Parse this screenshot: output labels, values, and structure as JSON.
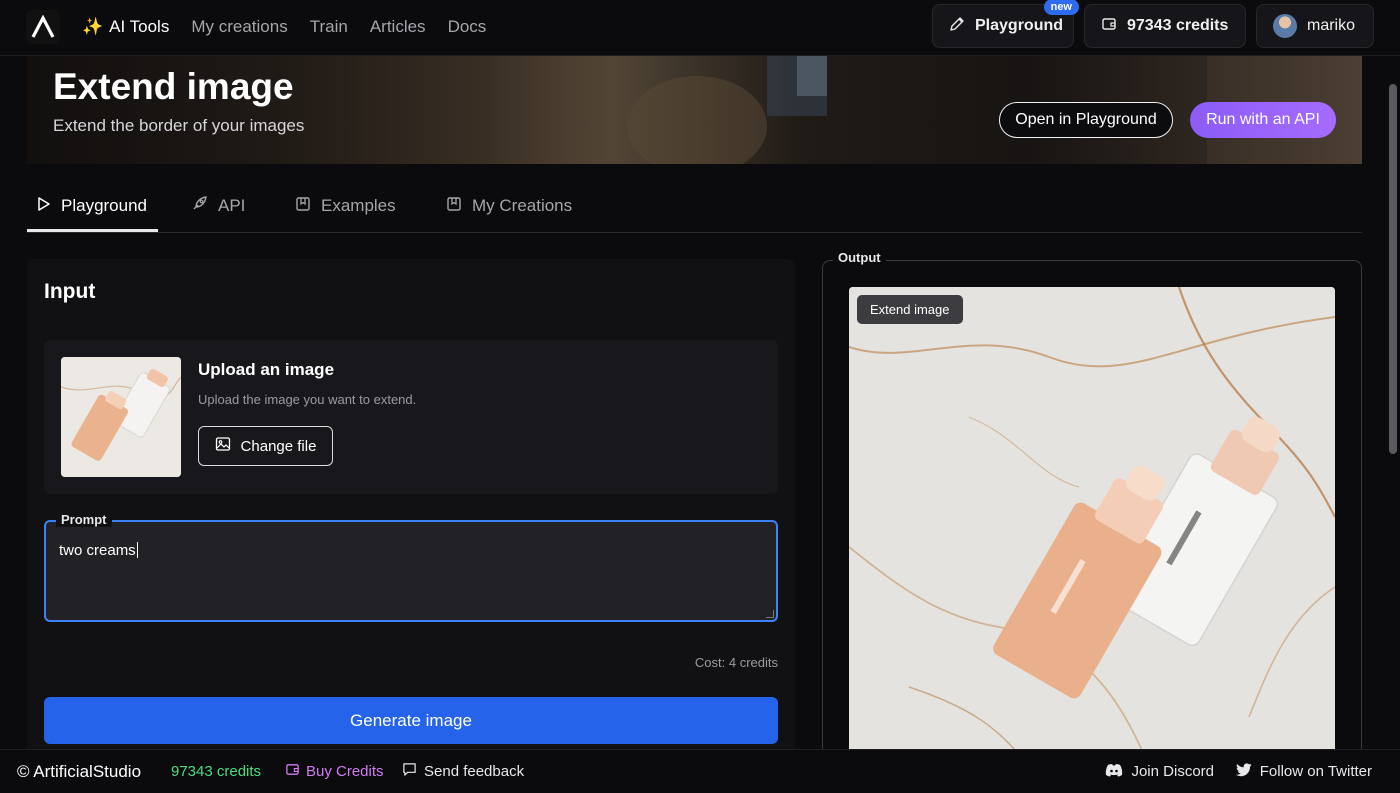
{
  "nav": {
    "logo_icon": "artificialstudio-logo-icon",
    "links": [
      {
        "label": "AI Tools",
        "active": true,
        "prefix_icon": "sparkle-icon"
      },
      {
        "label": "My creations",
        "active": false
      },
      {
        "label": "Train",
        "active": false
      },
      {
        "label": "Articles",
        "active": false
      },
      {
        "label": "Docs",
        "active": false
      }
    ],
    "sparkle": "✨",
    "playground_label": "Playground",
    "playground_badge": "new",
    "credits_label": "97343 credits",
    "user_name": "mariko"
  },
  "hero": {
    "title": "Extend image",
    "subtitle": "Extend the border of your images",
    "open_playground_label": "Open in Playground",
    "run_api_label": "Run with an API"
  },
  "tabs": [
    {
      "label": "Playground",
      "icon": "play-icon",
      "active": true
    },
    {
      "label": "API",
      "icon": "rocket-icon",
      "active": false
    },
    {
      "label": "Examples",
      "icon": "bookmark-icon",
      "active": false
    },
    {
      "label": "My Creations",
      "icon": "bookmark-icon",
      "active": false
    }
  ],
  "input": {
    "title": "Input",
    "upload_title": "Upload an image",
    "upload_subtitle": "Upload the image you want to extend.",
    "change_file_label": "Change file",
    "prompt_label": "Prompt",
    "prompt_value": "two creams",
    "cost": "Cost: 4 credits",
    "generate_label": "Generate image"
  },
  "output": {
    "label": "Output",
    "tag": "Extend image"
  },
  "footer": {
    "brand": "© ArtificialStudio",
    "credits": "97343 credits",
    "buy_credits": "Buy Credits",
    "send_feedback": "Send feedback",
    "join_discord": "Join Discord",
    "follow_twitter": "Follow on Twitter"
  },
  "colors": {
    "accent_blue": "#2563eb",
    "purple": "#a66bff",
    "credits_green": "#4ade80",
    "buy_pink": "#d17bf2"
  }
}
